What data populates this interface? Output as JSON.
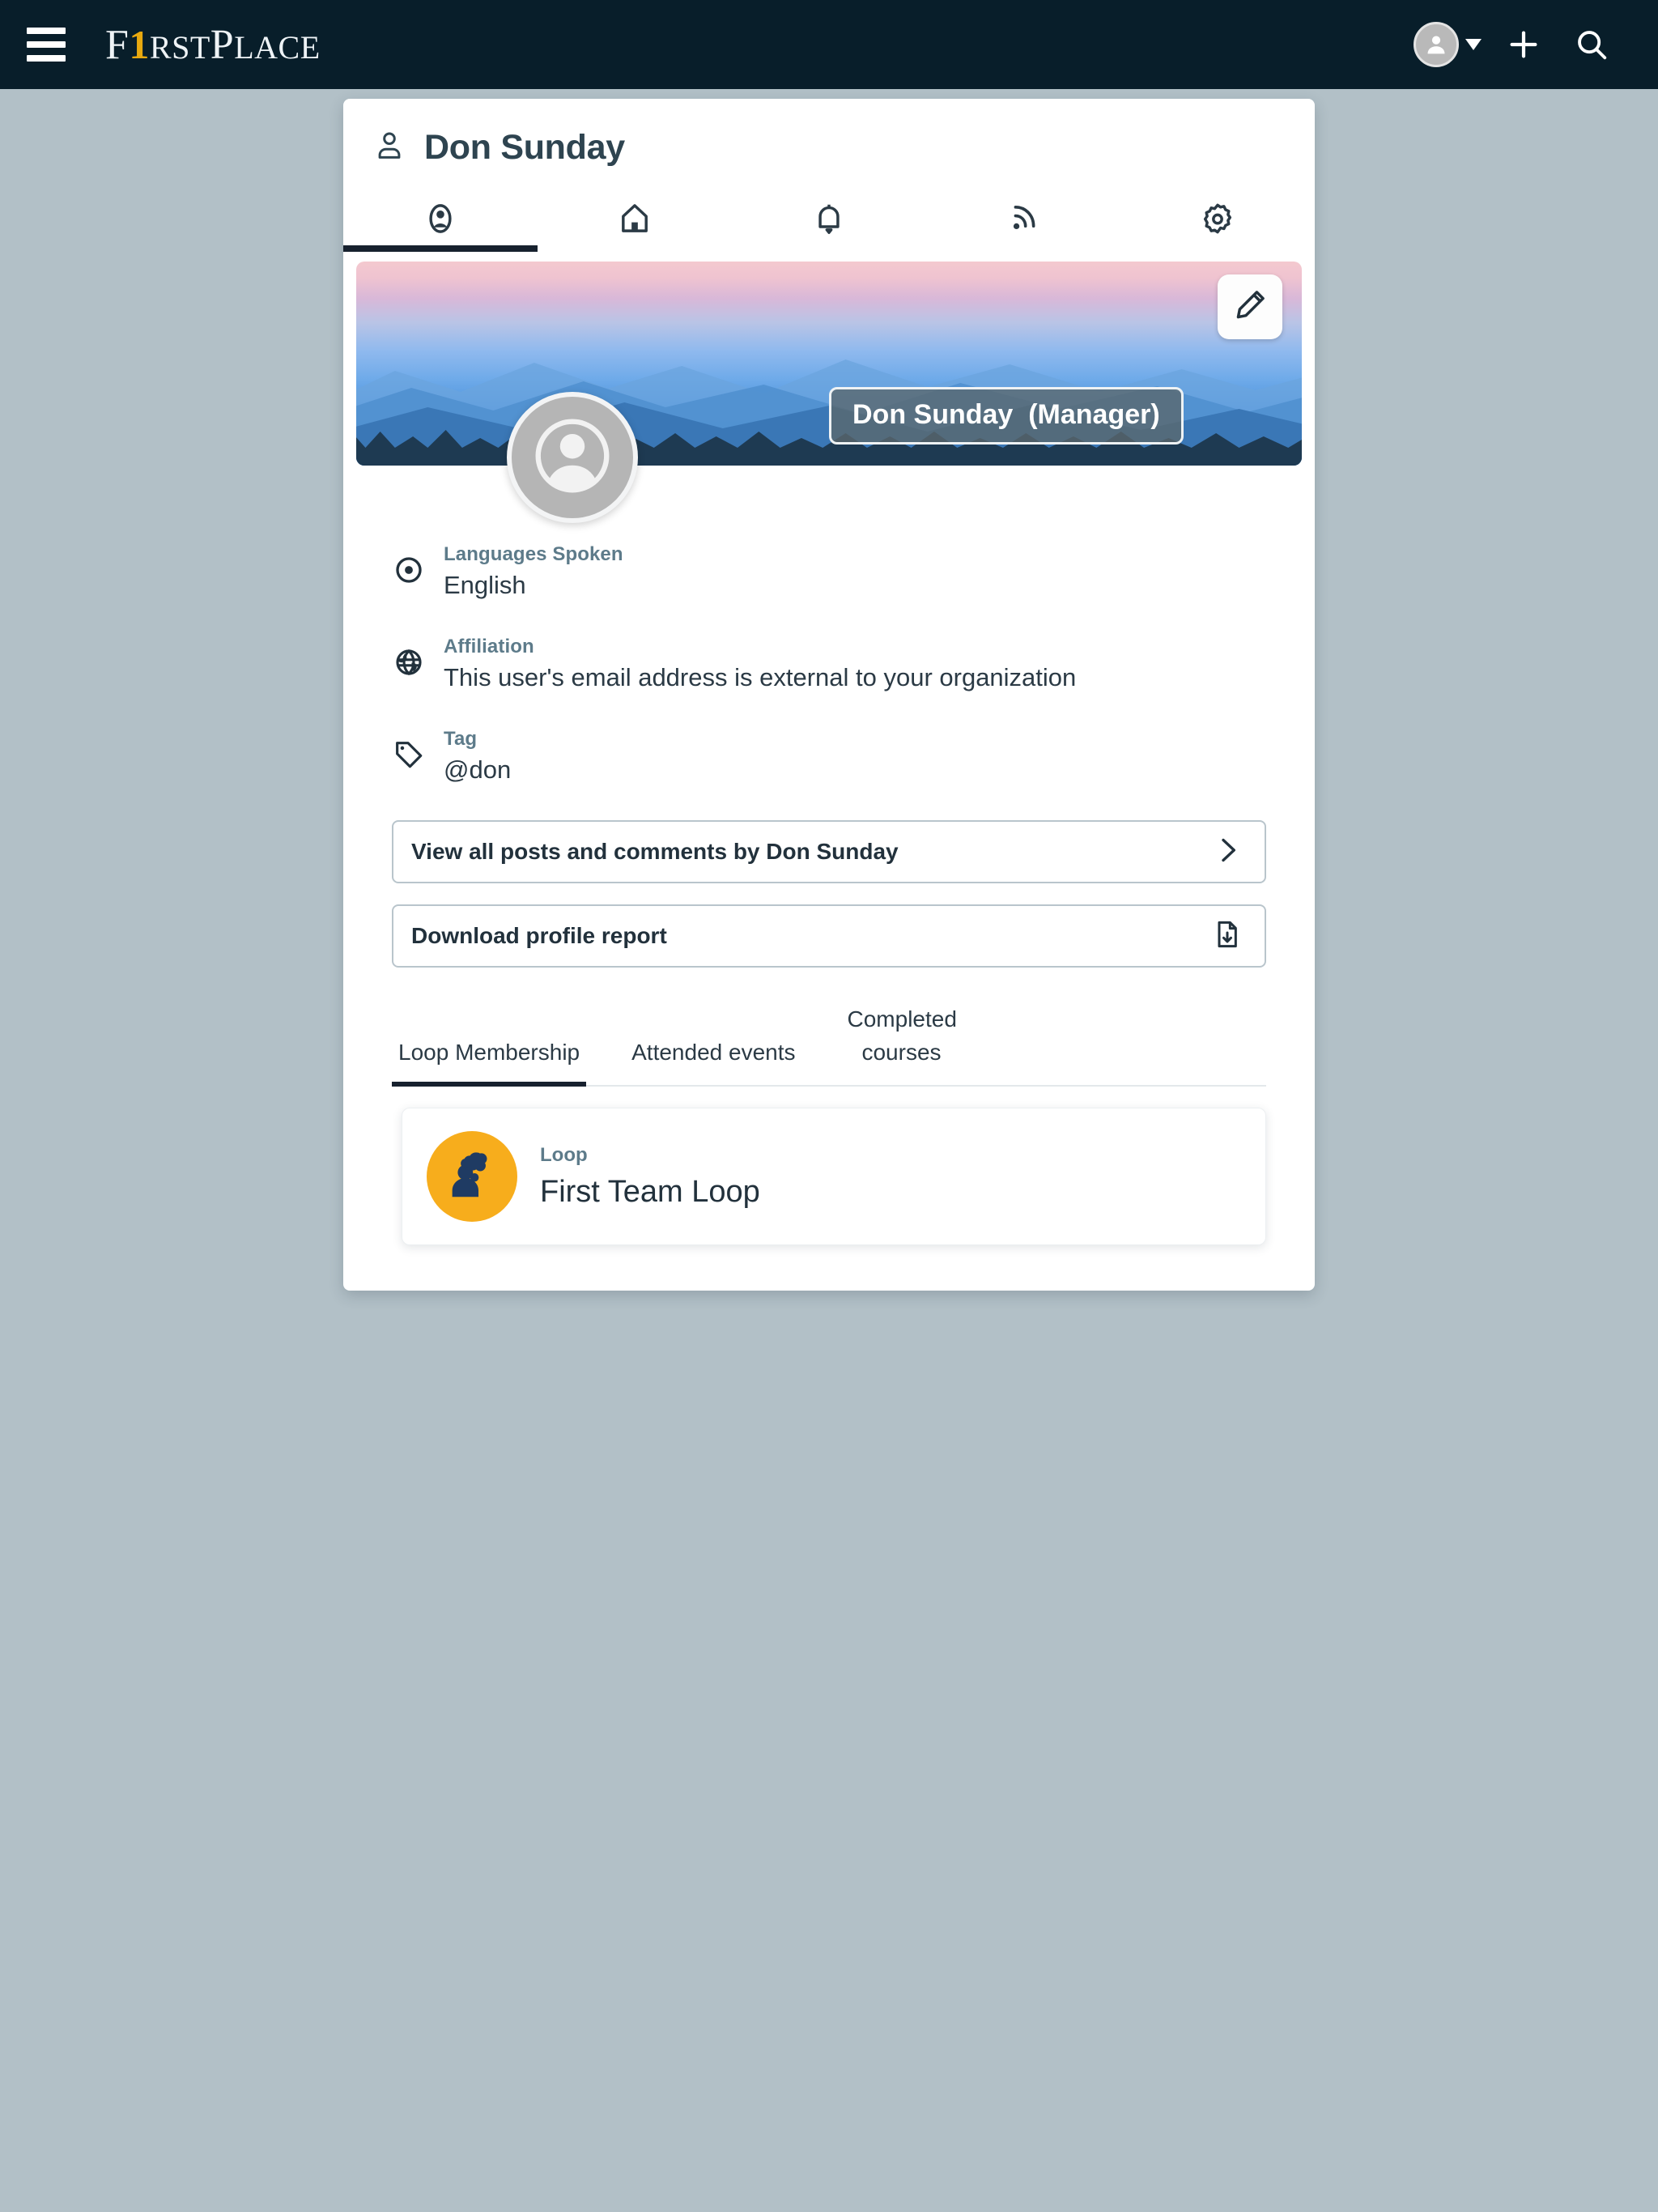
{
  "appbar": {
    "menu_icon": "hamburger-menu-icon",
    "logo": {
      "part1": "F",
      "part2": "1",
      "part3": "RST",
      "part4": "P",
      "part5": "LACE",
      "full_text": "F1RSTPLACE"
    },
    "account_icon": "user-avatar-icon",
    "caret_icon": "chevron-down-icon",
    "add_icon": "plus-icon",
    "search_icon": "search-icon",
    "background_color": "#081e2a",
    "accent_color": "#e8a90f"
  },
  "card": {
    "title": "Don Sunday",
    "title_icon": "person-icon",
    "tabs": [
      {
        "name": "profile",
        "icon": "user-circle-icon",
        "active": true
      },
      {
        "name": "home",
        "icon": "home-icon",
        "active": false
      },
      {
        "name": "notifications",
        "icon": "bell-icon",
        "active": false
      },
      {
        "name": "feed",
        "icon": "rss-feed-icon",
        "active": false
      },
      {
        "name": "settings",
        "icon": "gear-icon",
        "active": false
      }
    ]
  },
  "banner": {
    "edit_icon": "pencil-edit-icon",
    "name_badge": "Don Sunday  (Manager)",
    "avatar_icon": "user-avatar-icon"
  },
  "info": [
    {
      "label": "Languages Spoken",
      "value": "English",
      "icon": "target-circle-icon"
    },
    {
      "label": "Affiliation",
      "value": "This user's email address is external to your organization",
      "icon": "globe-icon"
    },
    {
      "label": "Tag",
      "value": "@don",
      "icon": "tag-icon"
    }
  ],
  "actions": [
    {
      "label": "View all posts and comments by Don Sunday",
      "icon": "chevron-right-icon"
    },
    {
      "label": "Download profile report",
      "icon": "file-download-icon"
    }
  ],
  "subtabs": [
    {
      "label": "Loop Membership",
      "active": true
    },
    {
      "label": "Attended events",
      "active": false
    },
    {
      "label": "Completed courses",
      "active": false
    }
  ],
  "loops": [
    {
      "kind": "Loop",
      "name": "First Team Loop",
      "icon": "loop-person-icon",
      "color": "#f7ad1c"
    }
  ],
  "colors": {
    "page_background": "#b2c0c7",
    "card_background": "#ffffff",
    "label_text": "#5d7b8a",
    "body_text": "#22313c",
    "active_underline": "#17212e"
  }
}
